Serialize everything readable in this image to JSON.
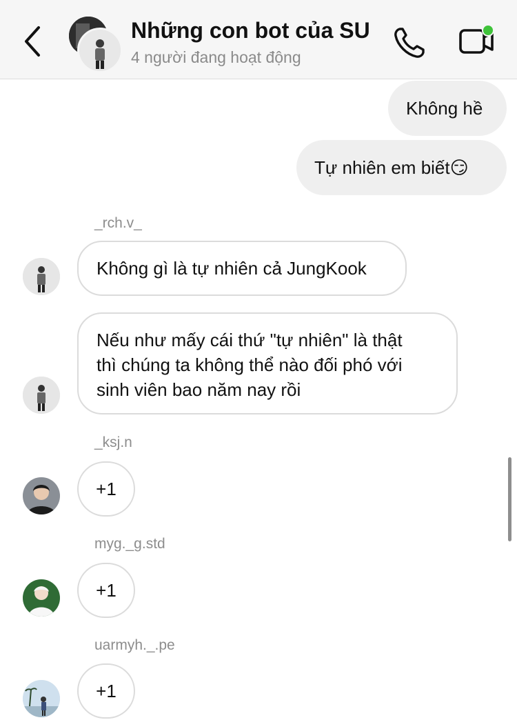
{
  "header": {
    "title": "Những con bot của SU",
    "subtitle": "4 người đang hoạt động",
    "icons": [
      "back-chevron-icon",
      "phone-icon",
      "video-camera-icon"
    ],
    "online_dot_color": "#3fc33a"
  },
  "messages": [
    {
      "direction": "outgoing",
      "text": "Không hề"
    },
    {
      "direction": "outgoing",
      "text": "Tự nhiên em biết",
      "emoji": "😏"
    },
    {
      "direction": "incoming",
      "sender": "_rch.v_",
      "text": "Không gì là tự nhiên cả JungKook"
    },
    {
      "direction": "incoming",
      "lines": [
        "Nếu như mấy cái thứ \"tự nhiên\" là thật",
        "thì chúng ta không thể nào đối phó với",
        "sinh viên bao năm nay rồi"
      ]
    },
    {
      "direction": "incoming",
      "sender": "_ksj.n",
      "text": "+1"
    },
    {
      "direction": "incoming",
      "sender": "myg._g.std",
      "text": "+1"
    },
    {
      "direction": "incoming",
      "sender": "uarmyh._.pe",
      "text": "+1"
    }
  ]
}
